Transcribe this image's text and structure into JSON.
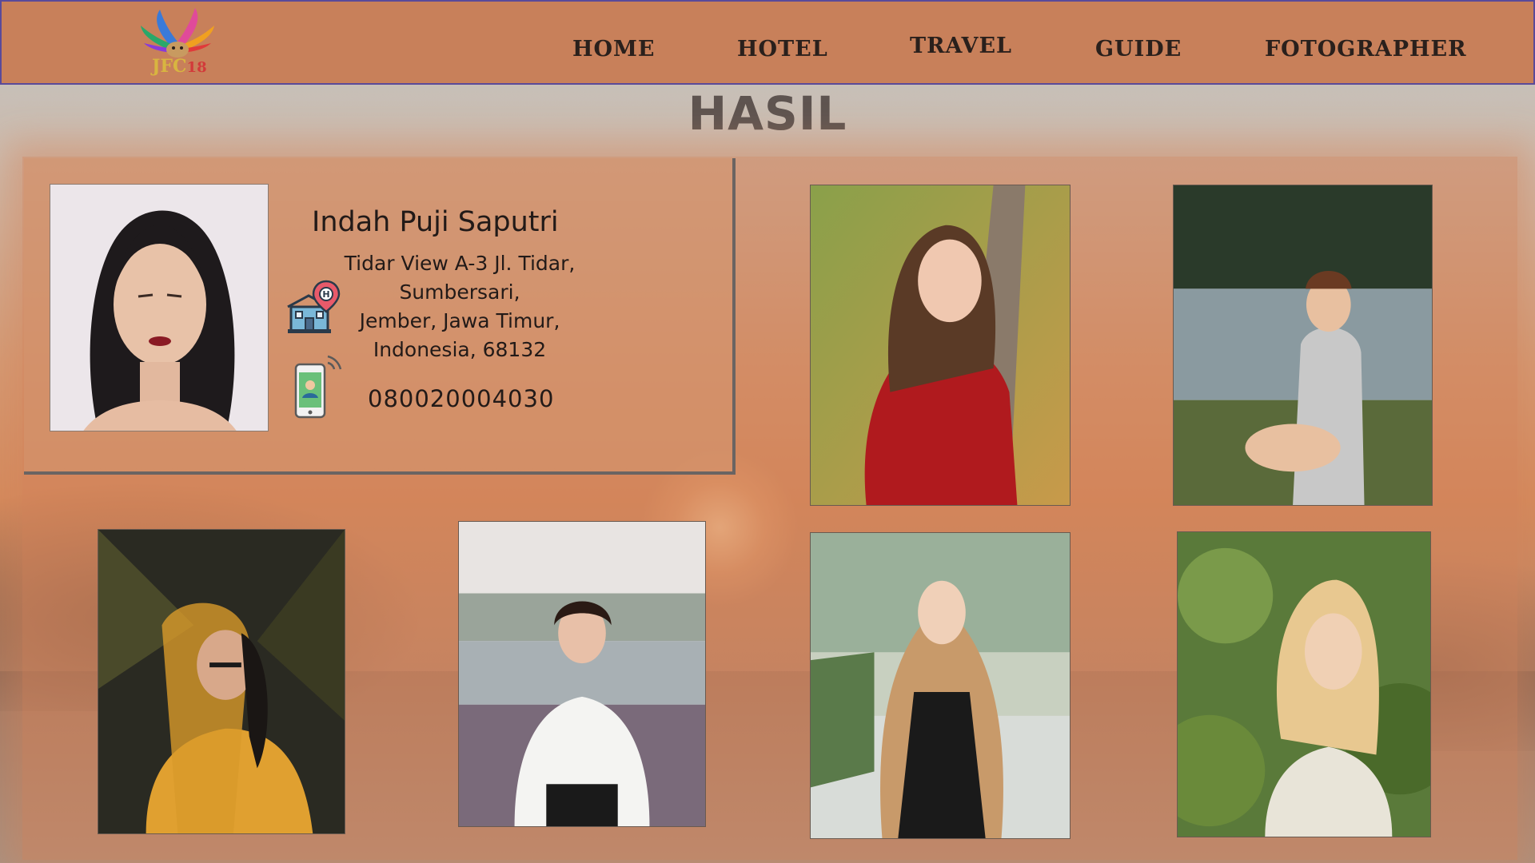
{
  "header": {
    "logo_text": "JFC",
    "logo_number": "18",
    "nav": [
      {
        "label": "HOME"
      },
      {
        "label": "HOTEL"
      },
      {
        "label": "TRAVEL"
      },
      {
        "label": "GUIDE"
      },
      {
        "label": "FOTOGRAPHER"
      }
    ]
  },
  "page": {
    "title": "HASIL"
  },
  "profile": {
    "name": "Indah Puji Saputri",
    "address_lines": [
      "Tidar View A-3 Jl. Tidar,",
      "Sumbersari,",
      "Jember, Jawa Timur,",
      "Indonesia, 68132"
    ],
    "phone": "080020004030"
  },
  "colors": {
    "header_bg": "#c8805a",
    "header_border": "#5a4a9a",
    "panel_bg": "#d2825a",
    "title_color": "#5e5450"
  },
  "icons": [
    "logo-icon",
    "hotel-location-icon",
    "phone-contact-icon"
  ]
}
